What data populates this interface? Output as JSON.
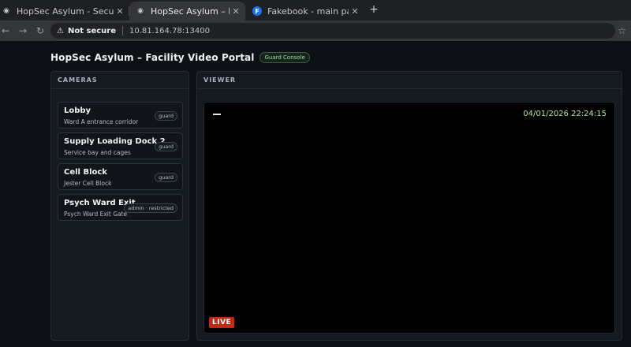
{
  "browser": {
    "tabs": [
      {
        "title": "HopSec Asylum - Security",
        "active": false
      },
      {
        "title": "HopSec Asylum – Facility",
        "active": true
      },
      {
        "title": "Fakebook - main page",
        "active": false
      }
    ],
    "new_tab": "+",
    "security_label": "Not secure",
    "url": "10.81.164.78:13400"
  },
  "page": {
    "title": "HopSec Asylum – Facility Video Portal",
    "badge": "Guard Console"
  },
  "cameras_panel": {
    "heading": "CAMERAS",
    "items": [
      {
        "name": "Lobby",
        "desc": "Ward A entrance corridor",
        "role": "guard"
      },
      {
        "name": "Supply Loading Dock 2",
        "desc": "Service bay and cages",
        "role": "guard"
      },
      {
        "name": "Cell Block",
        "desc": "Jester Cell Block",
        "role": "guard"
      },
      {
        "name": "Psych Ward Exit",
        "desc": "Psych Ward Exit Gate",
        "role": "admin · restricted"
      }
    ]
  },
  "viewer_panel": {
    "heading": "VIEWER",
    "timestamp": "04/01/2026 22:24:15",
    "live_label": "LIVE"
  },
  "colors": {
    "accent_green": "#b6e3a3",
    "live_red": "#c02a17",
    "background": "#0d1015"
  },
  "icons": [
    "back-icon",
    "forward-icon",
    "warning-icon",
    "star-icon",
    "close-icon",
    "facebook-icon"
  ]
}
